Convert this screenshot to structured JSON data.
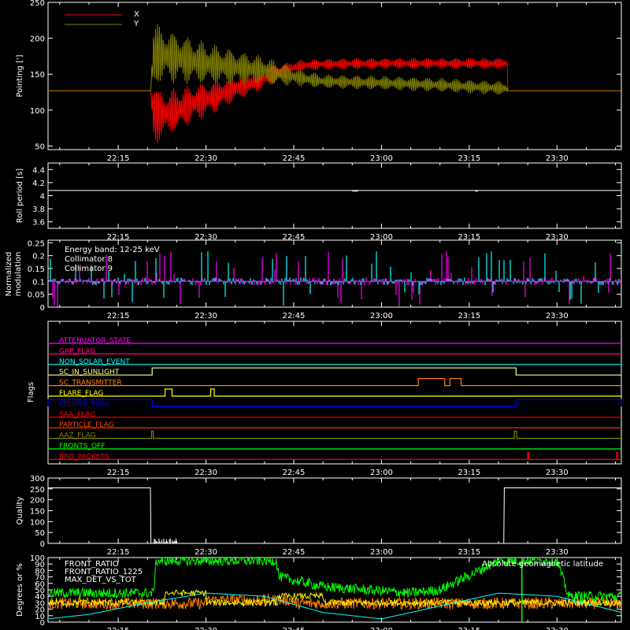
{
  "time_axis": {
    "tick_labels": [
      "22:15",
      "22:30",
      "22:45",
      "23:00",
      "23:15",
      "23:30"
    ],
    "tick_minutes": [
      15,
      30,
      45,
      60,
      75,
      90
    ],
    "range_minutes": [
      3,
      101
    ]
  },
  "colors": {
    "white": "#ffffff",
    "red": "#ff0000",
    "olive": "#808000",
    "cyan": "#00ffff",
    "magenta": "#ff00ff",
    "yellow": "#ffff00",
    "orange": "#ff8000",
    "green": "#00ff00",
    "blue": "#0000ff",
    "darkorange": "#ff7f00"
  },
  "chart_data": [
    {
      "type": "line",
      "ylabel": "Pointing [']",
      "ylim": [
        45,
        250
      ],
      "yticks": [
        50,
        100,
        150,
        200,
        250
      ],
      "legend_position": "top-left",
      "series": [
        {
          "name": "X",
          "color": "#ff0000",
          "x": [
            3,
            20.5,
            21,
            22,
            30,
            40,
            46,
            50,
            60,
            70,
            81.5,
            81.6,
            101
          ],
          "y_center": [
            127,
            127,
            95,
            92,
            115,
            145,
            162,
            164,
            165,
            165,
            165,
            127,
            127
          ],
          "amplitude": [
            0,
            0,
            60,
            35,
            25,
            15,
            8,
            8,
            8,
            8,
            8,
            0,
            0
          ]
        },
        {
          "name": "Y",
          "color": "#808000",
          "x": [
            3,
            20.5,
            21,
            22,
            30,
            40,
            46,
            50,
            60,
            70,
            81.5,
            81.6,
            101
          ],
          "y_center": [
            127,
            127,
            175,
            178,
            165,
            155,
            145,
            140,
            138,
            135,
            130,
            127,
            127
          ],
          "amplitude": [
            0,
            0,
            60,
            40,
            30,
            20,
            12,
            10,
            10,
            10,
            10,
            0,
            0
          ]
        }
      ]
    },
    {
      "type": "line",
      "ylabel": "Roll period [s]",
      "ylim": [
        3.5,
        4.5
      ],
      "yticks": [
        3.6,
        3.8,
        4.0,
        4.2,
        4.4
      ],
      "series": [
        {
          "name": "",
          "color": "#ffffff",
          "x": [
            3,
            101
          ],
          "y": [
            4.08,
            4.08
          ]
        }
      ]
    },
    {
      "type": "bar",
      "ylabel": "Normalized modulation",
      "ylim": [
        0.0,
        0.26
      ],
      "yticks": [
        0.0,
        0.05,
        0.1,
        0.15,
        0.2,
        0.25
      ],
      "legend_position": "top-left",
      "annotation": "Energy band: 12-25 keV",
      "series": [
        {
          "name": "Collimator 8",
          "color": "#00ffff",
          "baseline": 0.1
        },
        {
          "name": "Collimator 9",
          "color": "#ff00ff",
          "baseline": 0.1
        }
      ]
    },
    {
      "type": "line",
      "ylabel": "Flags",
      "flags": [
        {
          "name": "ATTENUATOR_STATE",
          "color": "#ff00ff",
          "high_intervals": []
        },
        {
          "name": "GAP_FLAG",
          "color": "#ff0080",
          "high_intervals": []
        },
        {
          "name": "NON_SOLAR_EVENT",
          "color": "#00ffff",
          "high_intervals": []
        },
        {
          "name": "SC_IN_SUNLIGHT",
          "color": "#ffff80",
          "high_intervals": [
            [
              20.8,
              83.0
            ]
          ]
        },
        {
          "name": "SC_TRANSMITTER",
          "color": "#ff8000",
          "high_intervals": [
            [
              66.3,
              70.8
            ],
            [
              71.7,
              73.6
            ]
          ]
        },
        {
          "name": "FLARE_FLAG",
          "color": "#ffff00",
          "high_intervals": [
            [
              23.0,
              24.2
            ],
            [
              30.8,
              31.4
            ]
          ]
        },
        {
          "name": "ECLIPSE_FLAG",
          "color": "#0000ff",
          "high_intervals": [
            [
              3,
              20.8
            ],
            [
              83.0,
              101
            ]
          ]
        },
        {
          "name": "SAA_FLAG",
          "color": "#ff0000",
          "high_intervals": []
        },
        {
          "name": "PARTICLE_FLAG",
          "color": "#ff4000",
          "high_intervals": []
        },
        {
          "name": "AAZ_FLAG",
          "color": "#808000",
          "high_intervals": [
            [
              20.7,
              21.0
            ],
            [
              82.7,
              83.1
            ]
          ]
        },
        {
          "name": "FRONTS_OFF",
          "color": "#00ff00",
          "high_intervals": []
        },
        {
          "name": "BAD_PACKETS",
          "color": "#ff0000",
          "high_intervals": [
            [
              85.0,
              85.15
            ],
            [
              100.2,
              100.35
            ]
          ]
        }
      ]
    },
    {
      "type": "line",
      "ylabel": "Quality",
      "ylim": [
        0,
        300
      ],
      "yticks": [
        0,
        50,
        100,
        150,
        200,
        250,
        300
      ],
      "series": [
        {
          "name": "",
          "color": "#ffffff",
          "x": [
            3,
            20.5,
            20.6,
            80.9,
            81.0,
            101
          ],
          "y": [
            255,
            255,
            0,
            0,
            255,
            255
          ]
        }
      ]
    },
    {
      "type": "line",
      "ylabel": "Degrees or %",
      "ylim": [
        0,
        100
      ],
      "yticks": [
        0,
        10,
        20,
        30,
        40,
        50,
        60,
        70,
        80,
        90,
        100
      ],
      "legend_position": "top-left",
      "series": [
        {
          "name": "FRONT_RATIO",
          "color": "#ffff00"
        },
        {
          "name": "FRONT_RATIO_1225",
          "color": "#00ff00"
        },
        {
          "name": "MAX_DET_VS_TOT",
          "color": "#ff7f00"
        },
        {
          "name": "Absolute geomagnetic latitude",
          "color": "#00ffff"
        }
      ],
      "green_levels": {
        "x": [
          3,
          21,
          21.5,
          42,
          42.5,
          50,
          65,
          70,
          80,
          85,
          90,
          92,
          101
        ],
        "y": [
          45,
          45,
          95,
          95,
          70,
          55,
          45,
          50,
          95,
          95,
          95,
          40,
          40
        ]
      },
      "latitude_curve": {
        "x": [
          3,
          10,
          20,
          30,
          40,
          50,
          60,
          70,
          80,
          90,
          101
        ],
        "y": [
          5,
          12,
          30,
          45,
          40,
          15,
          5,
          25,
          45,
          40,
          15
        ]
      }
    }
  ]
}
